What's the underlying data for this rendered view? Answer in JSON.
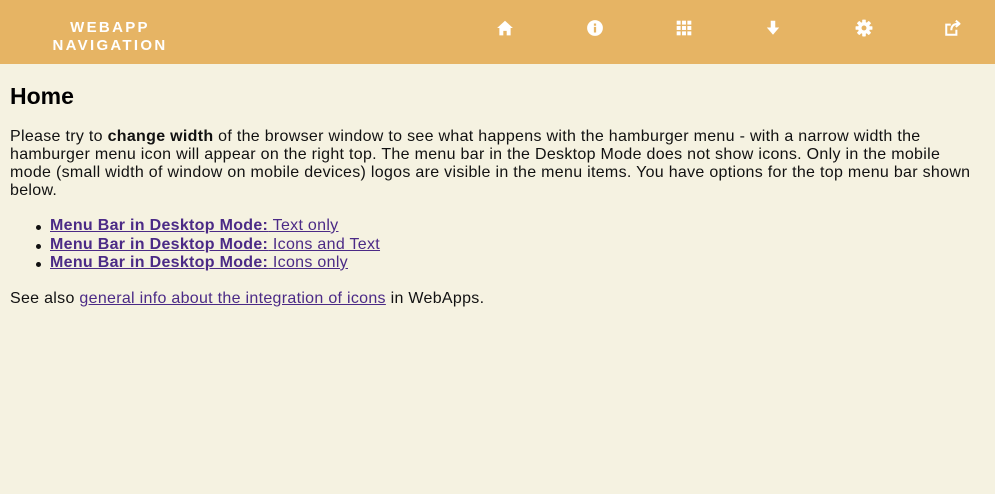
{
  "brand": {
    "line1": "WEBAPP",
    "line2": "NAVIGATION"
  },
  "nav": {
    "icons": [
      "home-icon",
      "info-icon",
      "grid-icon",
      "download-icon",
      "gear-icon",
      "share-icon"
    ]
  },
  "colors": {
    "topbar": "#e6b464",
    "background": "#f5f2e1",
    "link": "#4b2a86"
  },
  "main": {
    "title": "Home",
    "intro": {
      "part1": "Please try to ",
      "bold": "change width",
      "part2": " of the browser window to see what happens with the hamburger menu - with a narrow width the hamburger menu icon will appear on the right top. The menu bar in the Desktop Mode does not show icons. Only in the mobile mode (small width of window on mobile devices) logos are visible in the menu items. You have options for the top menu bar shown below."
    },
    "options": [
      {
        "bold": "Menu Bar in Desktop Mode:",
        "text": " Text only"
      },
      {
        "bold": "Menu Bar in Desktop Mode:",
        "text": " Icons and Text"
      },
      {
        "bold": "Menu Bar in Desktop Mode:",
        "text": " Icons only"
      }
    ],
    "see_also": {
      "prefix": "See also ",
      "link": "general info about the integration of icons",
      "suffix": " in WebApps."
    }
  }
}
